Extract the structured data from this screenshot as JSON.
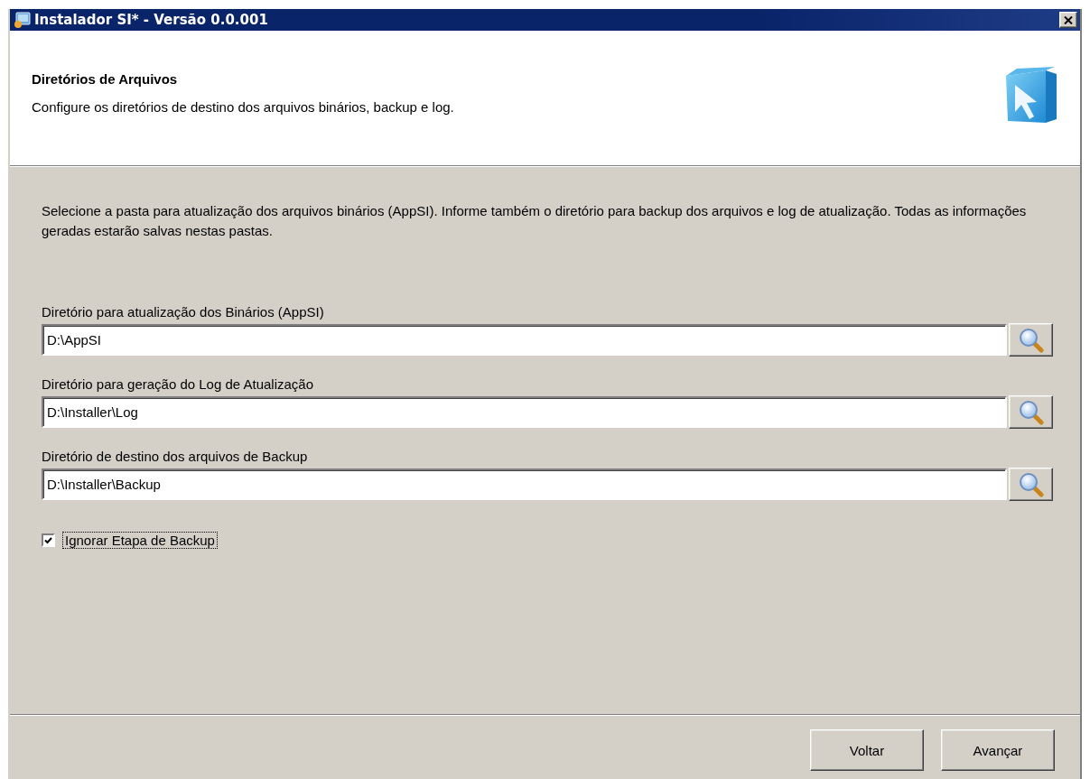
{
  "window": {
    "title": "Instalador SI* - Versão 0.0.001"
  },
  "header": {
    "title": "Diretórios de Arquivos",
    "subtitle": "Configure os diretórios de destino dos arquivos binários, backup e log."
  },
  "intro": "Selecione a pasta para atualização dos arquivos binários (AppSI). Informe também o diretório para backup dos arquivos e log de atualização. Todas as informações geradas estarão salvas nestas pastas.",
  "fields": [
    {
      "label": "Diretório para atualização dos Binários (AppSI)",
      "value": "D:\\AppSI"
    },
    {
      "label": "Diretório para geração do Log de Atualização",
      "value": "D:\\Installer\\Log"
    },
    {
      "label": "Diretório de destino dos arquivos de Backup",
      "value": "D:\\Installer\\Backup"
    }
  ],
  "skip_backup": {
    "label": "Ignorar Etapa de Backup",
    "checked": true,
    "focused": true
  },
  "buttons": [
    {
      "label": "Voltar"
    },
    {
      "label": "Avançar"
    }
  ]
}
